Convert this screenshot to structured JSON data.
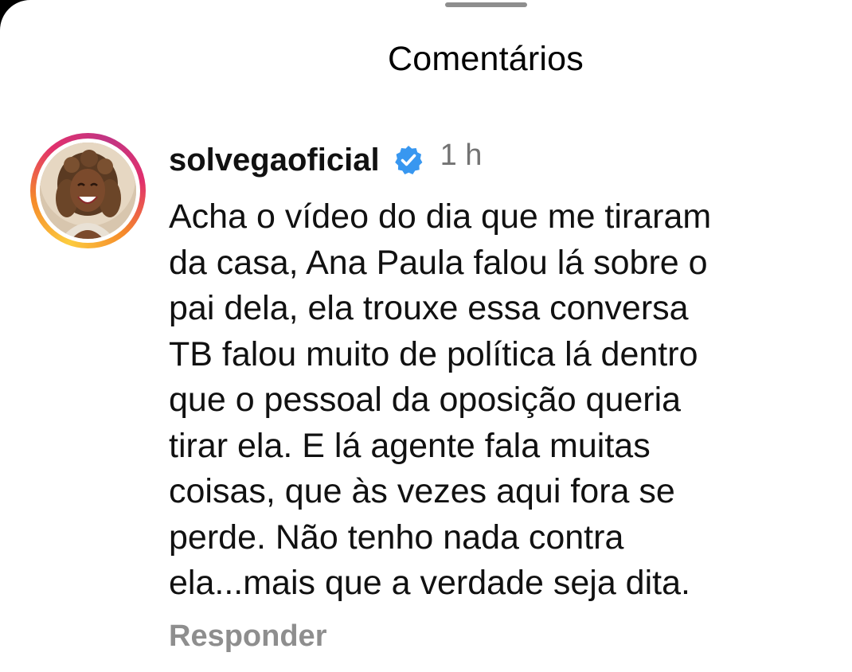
{
  "sheet": {
    "title": "Comentários"
  },
  "comment": {
    "username": "solvegaoficial",
    "verified": true,
    "timestamp": "1 h",
    "text": "Acha o vídeo do dia que me tiraram\nda casa, Ana Paula falou lá sobre o\npai dela, ela trouxe essa conversa\nTB falou muito de política lá dentro\nque o pessoal da oposição queria\ntirar ela. E lá agente fala muitas\ncoisas, que às vezes aqui fora se\nperde. Não tenho nada contra\nela...mais que a verdade seja dita.",
    "reply_label": "Responder"
  },
  "colors": {
    "verified_badge": "#3897f0",
    "muted_text": "#737373",
    "reply_text": "#8e8e8e"
  },
  "icons": {
    "verified": "verified-badge-icon",
    "avatar": "profile-photo"
  }
}
